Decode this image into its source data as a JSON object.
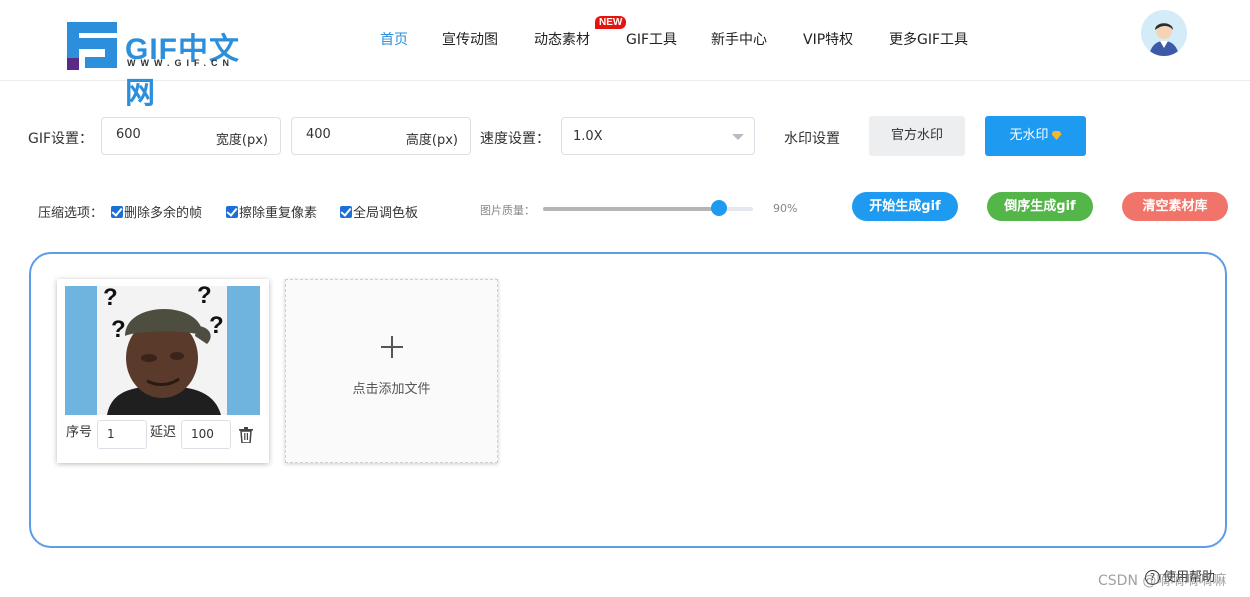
{
  "header": {
    "logo_text": "GIF中文网",
    "logo_sub": "WWW.GIF.CN",
    "nav": [
      {
        "label": "首页",
        "active": true
      },
      {
        "label": "宣传动图"
      },
      {
        "label": "动态素材"
      },
      {
        "label": "GIF工具"
      },
      {
        "label": "新手中心"
      },
      {
        "label": "VIP特权"
      },
      {
        "label": "更多GIF工具"
      }
    ],
    "new_badge": "NEW"
  },
  "settings": {
    "gif_label": "GIF设置：",
    "width_value": "600",
    "width_unit": "宽度(px)",
    "height_value": "400",
    "height_unit": "高度(px)",
    "speed_label": "速度设置：",
    "speed_value": "1.0X",
    "watermark_label": "水印设置",
    "watermark_official": "官方水印",
    "watermark_none": "无水印"
  },
  "compress": {
    "label": "压缩选项：",
    "options": [
      {
        "label": "删除多余的帧",
        "checked": true
      },
      {
        "label": "擦除重复像素",
        "checked": true
      },
      {
        "label": "全局调色板",
        "checked": true
      }
    ],
    "quality_label": "图片质量：",
    "quality_value": "90%",
    "quality_fraction": 0.9
  },
  "actions": {
    "start": "开始生成gif",
    "reverse": "倒序生成gif",
    "clear": "清空素材库",
    "colors": {
      "start": "#1e9bf0",
      "reverse": "#54b648",
      "clear": "#f07469"
    }
  },
  "frames": [
    {
      "order_label": "序号",
      "order": "1",
      "delay_label": "延迟",
      "delay": "100"
    }
  ],
  "add_file": "点击添加文件",
  "footer": {
    "help": "使用帮助",
    "watermark": "CSDN @嘀嘀嘀嘀嘛"
  }
}
